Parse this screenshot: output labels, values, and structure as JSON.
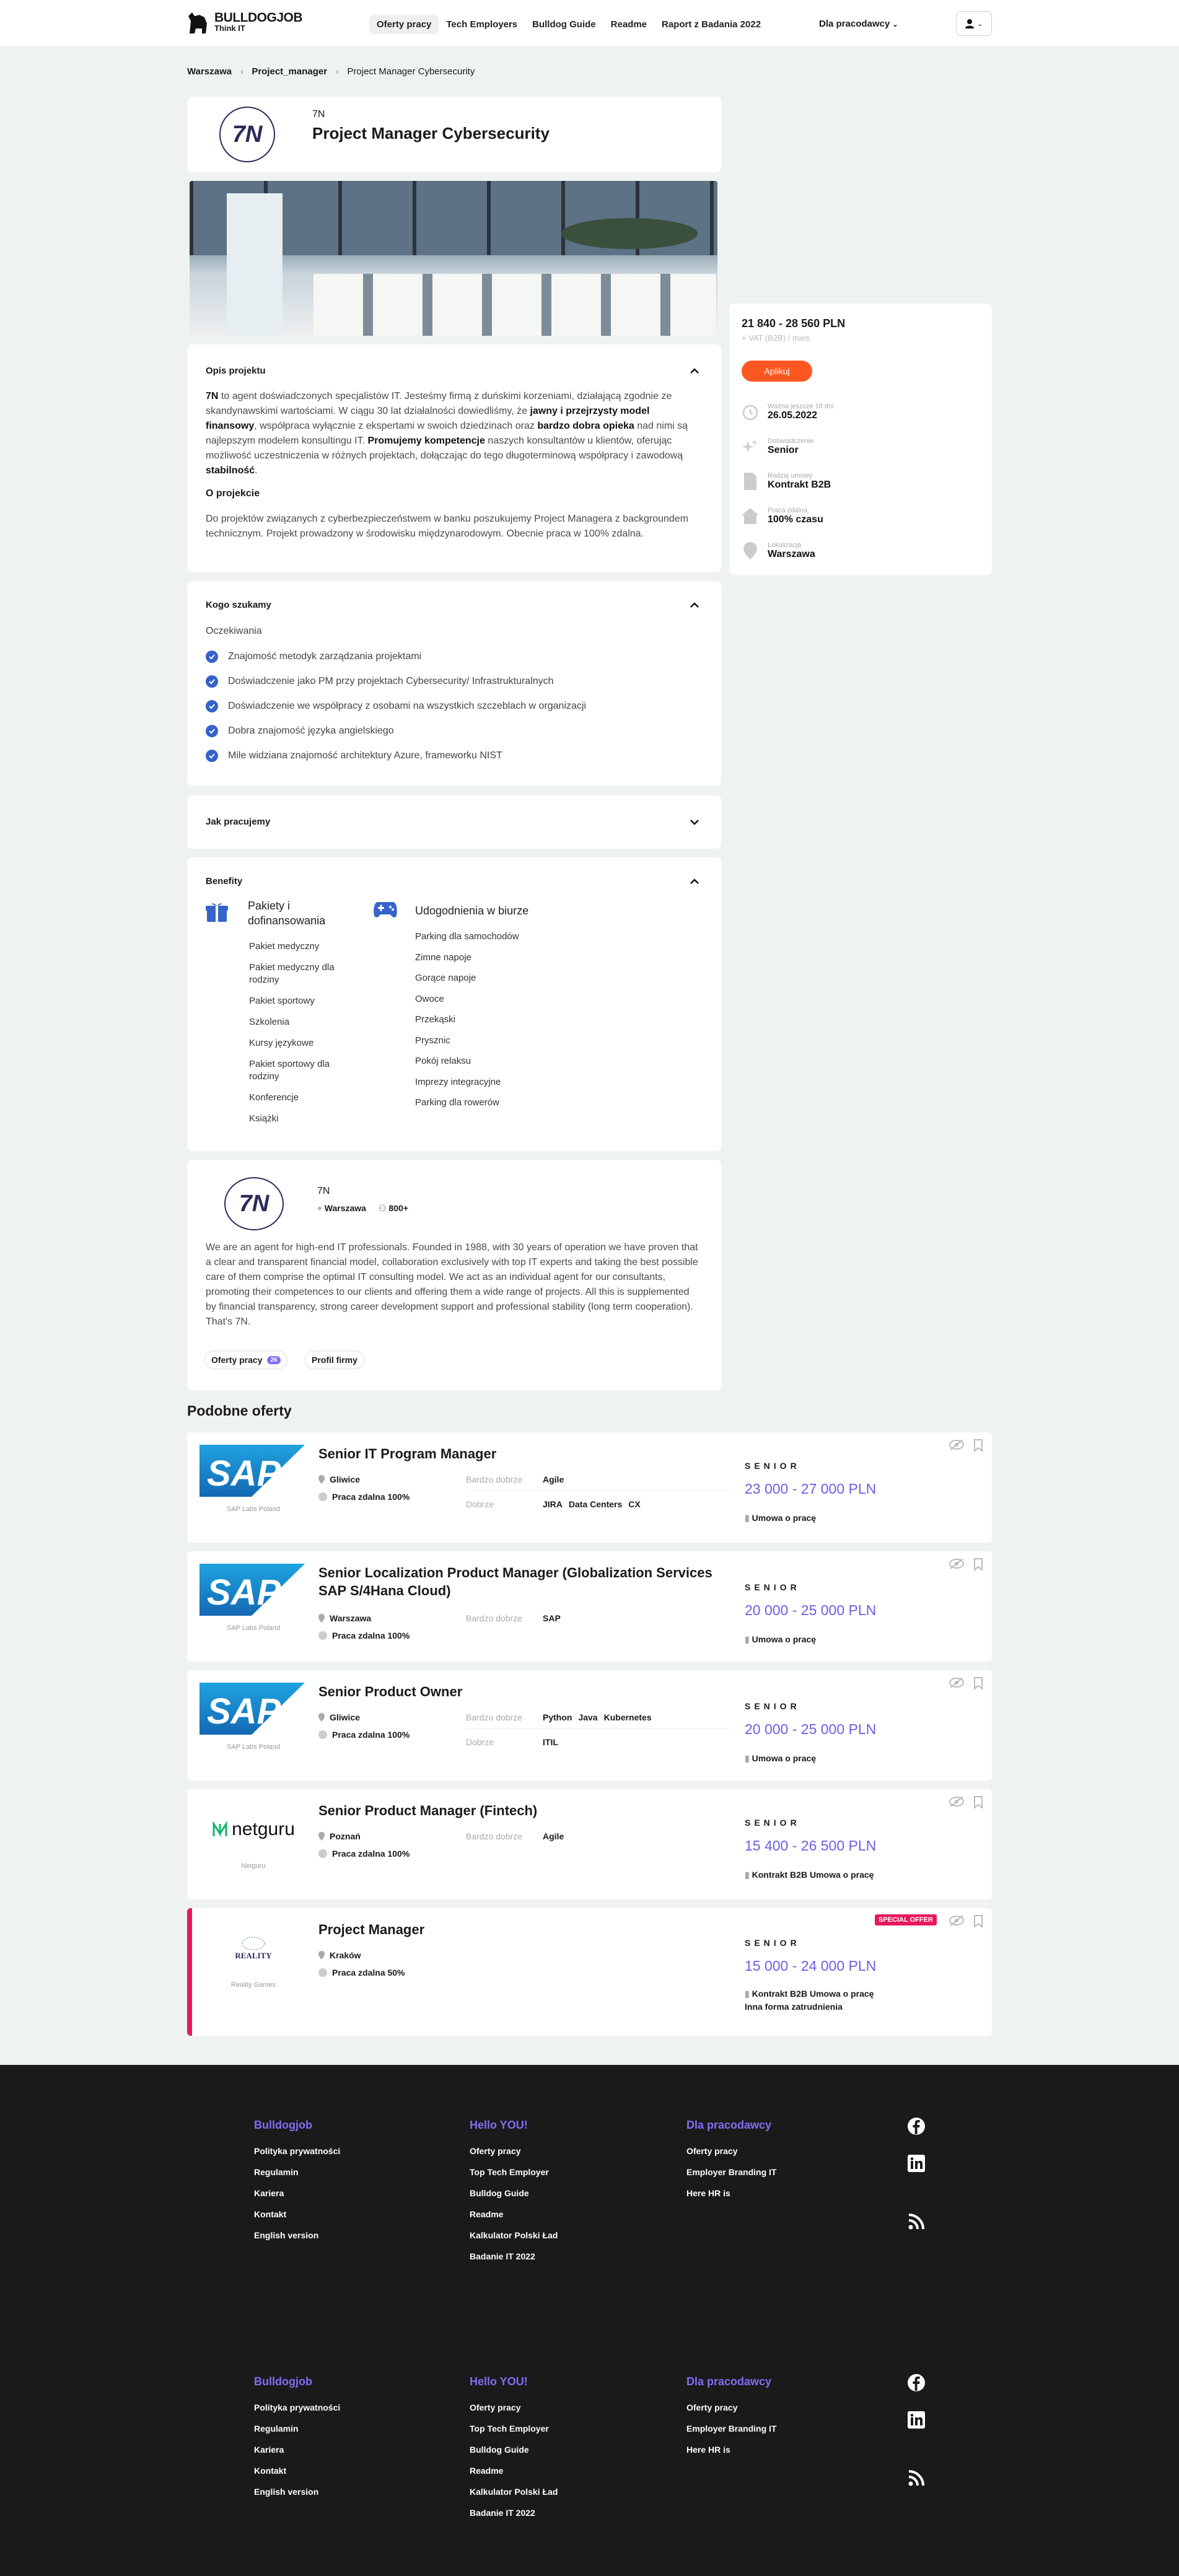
{
  "header": {
    "logo_title": "BULLDOGJOB",
    "logo_sub": "Think IT",
    "nav": [
      "Oferty pracy",
      "Tech Employers",
      "Bulldog Guide",
      "Readme",
      "Raport z Badania 2022"
    ],
    "employer": "Dla pracodawcy"
  },
  "breadcrumb": [
    "Warszawa",
    "Project_manager",
    "Project Manager Cybersecurity"
  ],
  "job": {
    "company": "7N",
    "logo_text": "7N",
    "title": "Project Manager Cybersecurity"
  },
  "description": {
    "title": "Opis projektu",
    "p1_parts": [
      "7N",
      " to agent doświadczonych specjalistów IT. Jesteśmy firmą z duńskimi korzeniami, działającą zgodnie ze skandynawskimi wartościami. W ciągu 30 lat działalności dowiedliśmy, że ",
      "jawny i przejrzysty model finansowy",
      ", współpraca wyłącznie z ekspertami w swoich dziedzinach oraz ",
      "bardzo dobra opieka",
      " nad nimi są najlepszym modelem konsultingu IT. ",
      "Promujemy kompetencje",
      " naszych konsultantów u klientów, oferując możliwość uczestniczenia w różnych projektach, dołączając do tego długoterminową współpracy i zawodową ",
      "stabilność",
      "."
    ],
    "subtitle": "O projekcie",
    "p2": "Do projektów związanych z cyberbezpieczeństwem w banku poszukujemy Project Managera z backgroundem technicznym. Projekt prowadzony w środowisku międzynarodowym. Obecnie praca w 100% zdalna."
  },
  "seeking": {
    "title": "Kogo szukamy",
    "subtitle": "Oczekiwania",
    "items": [
      "Znajomość metodyk zarządzania projektami",
      "Doświadczenie jako PM przy projektach Cybersecurity/ Infrastrukturalnych",
      "Doświadczenie we współpracy z osobami na wszystkich szczeblach w organizacji",
      "Dobra znajomość języka angielskiego",
      "Mile widziana znajomość architektury Azure, frameworku NIST"
    ]
  },
  "how": {
    "title": "Jak pracujemy"
  },
  "benefits": {
    "title": "Benefity",
    "col1_title": "Pakiety i dofinansowania",
    "col1": [
      "Pakiet medyczny",
      "Pakiet medyczny dla rodziny",
      "Pakiet sportowy",
      "Szkolenia",
      "Kursy językowe",
      "Pakiet sportowy dla rodziny",
      "Konferencje",
      "Książki"
    ],
    "col2_title": "Udogodnienia w biurze",
    "col2": [
      "Parking dla samochodów",
      "Zimne napoje",
      "Gorące napoje",
      "Owoce",
      "Przekąski",
      "Prysznic",
      "Pokój relaksu",
      "Imprezy integracyjne",
      "Parking dla rowerów"
    ]
  },
  "company_card": {
    "name": "7N",
    "city": "Warszawa",
    "size": "800+",
    "about": "We are an agent for high-end IT professionals. Founded in 1988, with 30 years of operation we have proven that a clear and transparent financial model, collaboration exclusively with top IT experts and taking the best possible care of them comprise the optimal IT consulting model. We act as an individual agent for our consultants, promoting their competences to our clients and offering them a wide range of projects. All this is supplemented by financial transparency, strong career development support and professional stability (long term cooperation). That's 7N.",
    "btn_offers": "Oferty pracy",
    "offers_count": "26",
    "btn_profile": "Profil firmy"
  },
  "side": {
    "salary": "21 840 - 28 560 PLN",
    "salary_note": "+ VAT (B2B) / mies.",
    "apply": "Aplikuj",
    "rows": [
      {
        "label": "Ważna jeszcze 18 dni",
        "value": "26.05.2022",
        "icon": "clock-icon"
      },
      {
        "label": "Doświadczenie",
        "value": "Senior",
        "icon": "sparkle-icon"
      },
      {
        "label": "Rodzaj umowy",
        "value": "Kontrakt B2B",
        "icon": "document-icon"
      },
      {
        "label": "Praca zdalna",
        "value": "100% czasu",
        "icon": "home-icon"
      },
      {
        "label": "Lokalizacja",
        "value": "Warszawa",
        "icon": "location-icon"
      }
    ]
  },
  "similar": {
    "title": "Podobne oferty",
    "nice_label": "Bardzo dobrze",
    "good_label": "Dobrze",
    "offers": [
      {
        "company": "SAP Labs Poland",
        "logo": "SAP",
        "title": "Senior IT Program Manager",
        "city": "Gliwice",
        "remote": "Praca zdalna 100%",
        "nice": [
          "Agile"
        ],
        "good": [
          "JIRA",
          "Data Centers",
          "CX"
        ],
        "level": "SENIOR",
        "salary": "23 000 - 27 000 PLN",
        "contract": "Umowa o pracę"
      },
      {
        "company": "SAP Labs Poland",
        "logo": "SAP",
        "title": "Senior Localization Product Manager (Globalization Services SAP S/4Hana Cloud)",
        "city": "Warszawa",
        "remote": "Praca zdalna 100%",
        "nice": [
          "SAP"
        ],
        "good": [],
        "level": "SENIOR",
        "salary": "20 000 - 25 000 PLN",
        "contract": "Umowa o pracę"
      },
      {
        "company": "SAP Labs Poland",
        "logo": "SAP",
        "title": "Senior Product Owner",
        "city": "Gliwice",
        "remote": "Praca zdalna 100%",
        "nice": [
          "Python",
          "Java",
          "Kubernetes"
        ],
        "good": [
          "ITIL"
        ],
        "level": "SENIOR",
        "salary": "20 000 - 25 000 PLN",
        "contract": "Umowa o pracę"
      },
      {
        "company": "Netguru",
        "logo": "netguru",
        "title": "Senior Product Manager (Fintech)",
        "city": "Poznań",
        "remote": "Praca zdalna 100%",
        "nice": [
          "Agile"
        ],
        "good": [],
        "level": "SENIOR",
        "salary": "15 400 - 26 500 PLN",
        "contract": "Kontrakt B2B  Umowa o pracę"
      },
      {
        "company": "Reality Games",
        "logo": "REALITY",
        "title": "Project Manager",
        "city": "Kraków",
        "remote": "Praca zdalna 50%",
        "nice": [],
        "good": [],
        "level": "SENIOR",
        "salary": "15 000 - 24 000 PLN",
        "contract": "Kontrakt B2B  Umowa o pracę",
        "contract2": "Inna forma zatrudnienia",
        "badge": "SPECIAL OFFER"
      }
    ]
  },
  "footer": {
    "cols": [
      {
        "title": "Bulldogjob",
        "items": [
          "Polityka prywatności",
          "Regulamin",
          "Kariera",
          "Kontakt",
          "English version"
        ]
      },
      {
        "title": "Hello YOU!",
        "items": [
          "Oferty pracy",
          "Top Tech Employer",
          "Bulldog Guide",
          "Readme",
          "Kalkulator Polski Ład",
          "Badanie IT 2022"
        ]
      },
      {
        "title": "Dla pracodawcy",
        "items": [
          "Oferty pracy",
          "Employer Branding IT",
          "Here HR is"
        ]
      }
    ],
    "social": [
      "facebook-icon",
      "linkedin-icon",
      "rss-icon"
    ]
  },
  "colors": {
    "accent": "#7f6ef5",
    "apply": "#ff5722",
    "check": "#3563c9",
    "special": "#e8175d"
  }
}
